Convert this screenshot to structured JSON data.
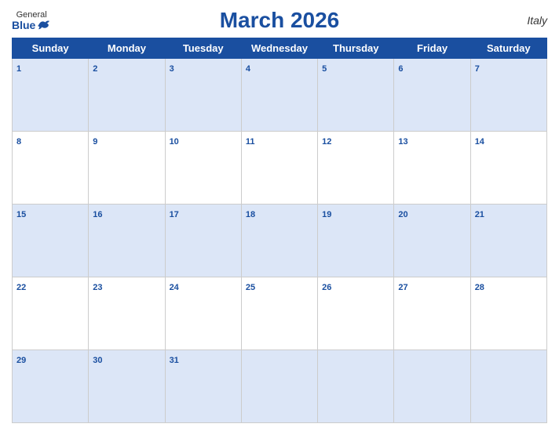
{
  "header": {
    "title": "March 2026",
    "country": "Italy",
    "logo_general": "General",
    "logo_blue": "Blue"
  },
  "weekdays": [
    "Sunday",
    "Monday",
    "Tuesday",
    "Wednesday",
    "Thursday",
    "Friday",
    "Saturday"
  ],
  "weeks": [
    [
      1,
      2,
      3,
      4,
      5,
      6,
      7
    ],
    [
      8,
      9,
      10,
      11,
      12,
      13,
      14
    ],
    [
      15,
      16,
      17,
      18,
      19,
      20,
      21
    ],
    [
      22,
      23,
      24,
      25,
      26,
      27,
      28
    ],
    [
      29,
      30,
      31,
      null,
      null,
      null,
      null
    ]
  ],
  "colors": {
    "header_bg": "#1a4fa0",
    "row_alt": "#dce6f7",
    "text_blue": "#1a4fa0"
  }
}
